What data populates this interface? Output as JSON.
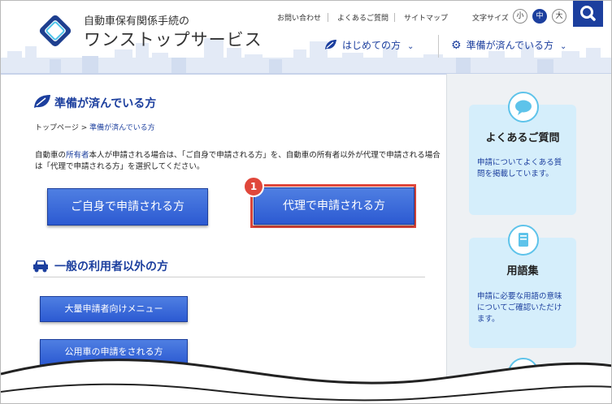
{
  "header": {
    "logo_line1": "自動車保有関係手続の",
    "logo_line2": "ワンストップサービス",
    "util_links": [
      "お問い合わせ",
      "よくあるご質問",
      "サイトマップ"
    ],
    "font_size_label": "文字サイズ",
    "font_sizes": [
      "小",
      "中",
      "大"
    ],
    "font_size_selected": "中",
    "nav": [
      "はじめての方",
      "準備が済んでいる方"
    ],
    "accent_color": "#1c3f9e"
  },
  "main": {
    "title": "準備が済んでいる方",
    "breadcrumb": {
      "home": "トップページ",
      "sep": " > ",
      "current": "準備が済んでいる方"
    },
    "desc_before": "自動車の",
    "desc_link": "所有者",
    "desc_after": "本人が申請される場合は、「ご自身で申請される方」を、自動車の所有者以外が代理で申請される場合は「代理で申請される方」を選択してください。",
    "self_button": "ご自身で申請される方",
    "proxy_button": "代理で申請される方",
    "step_badge": "1",
    "section_title": "一般の利用者以外の方",
    "bulk_button": "大量申請者向けメニュー",
    "public_button": "公用車の申請をされる方"
  },
  "sidebar": {
    "faq_title": "よくあるご質問",
    "faq_text": "申請についてよくある質問を掲載しています。",
    "glossary_title": "用語集",
    "glossary_text": "申請に必要な用語の意味についてご確認いただけます。"
  }
}
